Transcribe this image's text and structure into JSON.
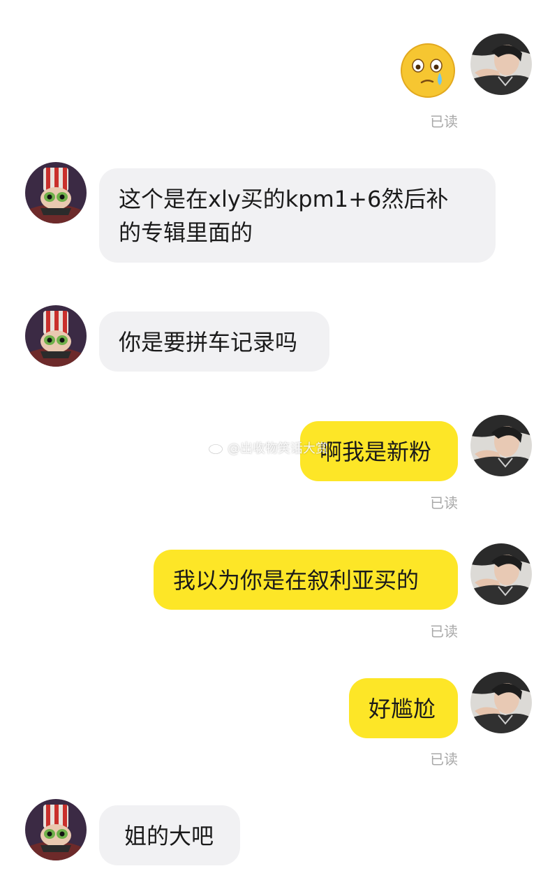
{
  "colors": {
    "sent_bubble": "#fde627",
    "received_bubble": "#f1f1f3",
    "read_receipt": "#a8a8a8"
  },
  "messages": [
    {
      "sender": "me",
      "type": "sticker",
      "sticker": "crying-face-emoji",
      "read": "已读"
    },
    {
      "sender": "other",
      "type": "text",
      "text": "这个是在xly买的kpm1+6然后补\n的专辑里面的"
    },
    {
      "sender": "other",
      "type": "text",
      "text": "你是要拼车记录吗"
    },
    {
      "sender": "me",
      "type": "text",
      "text": "啊我是新粉",
      "read": "已读"
    },
    {
      "sender": "me",
      "type": "text",
      "text": "我以为你是在叙利亚买的",
      "read": "已读"
    },
    {
      "sender": "me",
      "type": "text",
      "text": "好尴尬",
      "read": "已读"
    },
    {
      "sender": "other",
      "type": "text",
      "text": "姐的大吧"
    }
  ],
  "watermark": {
    "icon": "weibo-icon",
    "text": "@出收物笑话大赏"
  }
}
